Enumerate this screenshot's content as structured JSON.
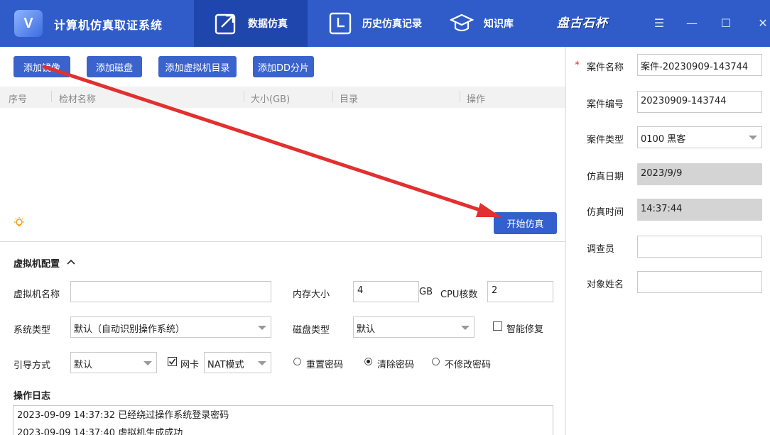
{
  "app": {
    "title": "计算机仿真取证系统",
    "logo_letter": "V",
    "brand": "盘古石杯"
  },
  "nav": [
    {
      "label": "数据仿真",
      "icon": "external-window-icon",
      "active": true
    },
    {
      "label": "历史仿真记录",
      "icon": "clock-icon",
      "active": false
    },
    {
      "label": "知识库",
      "icon": "graduation-cap-icon",
      "active": false
    }
  ],
  "window": {
    "menu": "☰",
    "minimize": "—",
    "maximize": "☐",
    "close": "✕"
  },
  "toolbar": {
    "add_image": "添加镜像",
    "add_disk": "添加磁盘",
    "add_vm_dir": "添加虚拟机目录",
    "add_dd": "添加DD分片"
  },
  "table": {
    "columns": [
      "序号",
      "检材名称",
      "大小(GB)",
      "目录",
      "操作"
    ],
    "rows": []
  },
  "start_button": "开始仿真",
  "vm_config": {
    "title": "虚拟机配置",
    "vm_name_label": "虚拟机名称",
    "vm_name_value": "",
    "memory_label": "内存大小",
    "memory_value": "4",
    "memory_unit": "GB",
    "cpu_label": "CPU核数",
    "cpu_value": "2",
    "os_type_label": "系统类型",
    "os_type_value": "默认（自动识别操作系统）",
    "disk_type_label": "磁盘类型",
    "disk_type_value": "默认",
    "smart_repair_label": "智能修复",
    "smart_repair_checked": false,
    "boot_label": "引导方式",
    "boot_value": "默认",
    "nic_label": "网卡",
    "nic_checked": true,
    "nic_mode_value": "NAT模式",
    "password_options": [
      {
        "label": "重置密码",
        "selected": false
      },
      {
        "label": "清除密码",
        "selected": true
      },
      {
        "label": "不修改密码",
        "selected": false
      }
    ]
  },
  "log": {
    "title": "操作日志",
    "lines": [
      "2023-09-09 14:37:32 已经绕过操作系统登录密码",
      "2023-09-09 14:37:40 虚拟机生成成功"
    ]
  },
  "case": {
    "required_mark": "*",
    "name_label": "案件名称",
    "name_value": "案件-20230909-143744",
    "number_label": "案件编号",
    "number_value": "20230909-143744",
    "type_label": "案件类型",
    "type_value": "0100 黑客",
    "date_label": "仿真日期",
    "date_value": "2023/9/9",
    "time_label": "仿真时间",
    "time_value": "14:37:44",
    "investigator_label": "调查员",
    "investigator_value": "",
    "subject_label": "对象姓名",
    "subject_value": ""
  },
  "colors": {
    "header": "#2f5cc8",
    "nav_active": "#1f46ad",
    "button": "#3a63cc",
    "arrow": "#e23030",
    "required": "#e03030"
  }
}
